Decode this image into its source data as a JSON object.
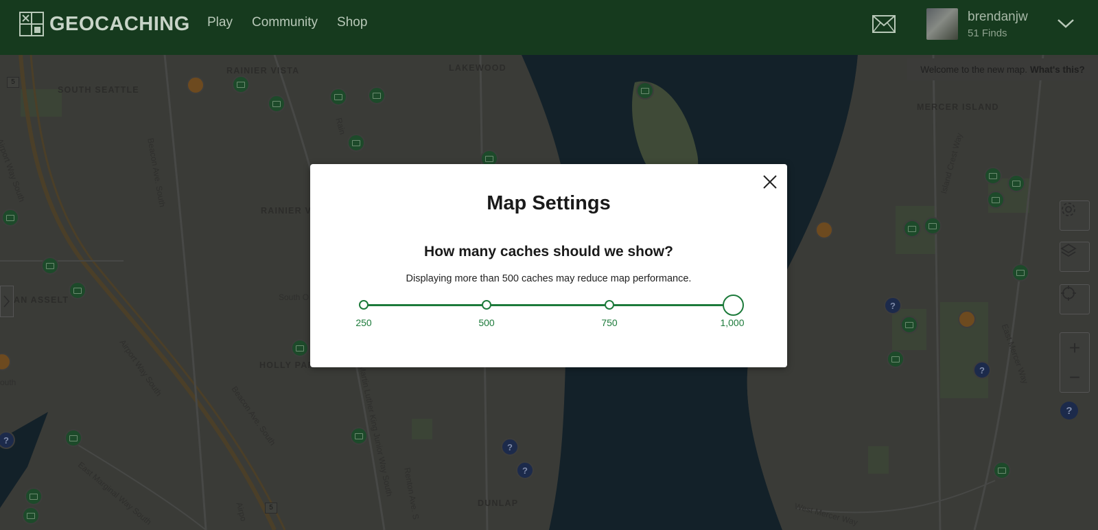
{
  "header": {
    "logo_text": "GEOCACHING",
    "nav": [
      "Play",
      "Community",
      "Shop"
    ],
    "user": {
      "name": "brendanjw",
      "finds": "51 Finds"
    }
  },
  "map": {
    "banner_text": "Welcome to the new map.",
    "banner_link": "What's this?",
    "place_labels": {
      "rainier_vista": "RAINIER VISTA",
      "lakewood": "LAKEWOOD",
      "south_seattle": "SOUTH SEATTLE",
      "mercer_island": "MERCER ISLAND",
      "rainier_valley": "RAINIER V",
      "an_assel": "AN ASSELT",
      "holly_park": "HOLLY PAR",
      "dunlap": "DUNLAP"
    },
    "road_labels": {
      "beacon_ave_south": "Beacon Ave. South",
      "airport_way_south": "Airport Way South",
      "airport_way_south_2": "Airport Way South",
      "east_marginal": "East Marginal Way South",
      "island_crest": "Island Crest Way",
      "east_mercer": "East Mercer Way",
      "martin_luther_king": "Martin Luther King Junior Way South",
      "renton_ave": "Renton Ave. S",
      "rainier": "Rain",
      "airport_left": "Airport Way South",
      "south_o": "South O",
      "west_mercer": "West Mercer Way",
      "south_left": "outh",
      "airport_bottom": "Airpo",
      "beacon_bottom": "Beacon Ave. South"
    },
    "highway_shield": "5",
    "highway_shield_2": "5",
    "help_glyph": "?"
  },
  "modal": {
    "title": "Map Settings",
    "subtitle": "How many caches should we show?",
    "note": "Displaying more than 500 caches may reduce map performance.",
    "slider": {
      "options": [
        "250",
        "500",
        "750",
        "1,000"
      ],
      "selected_index": 3
    }
  },
  "colors": {
    "header_bg": "#163a1e",
    "accent": "#1c7a3a"
  }
}
